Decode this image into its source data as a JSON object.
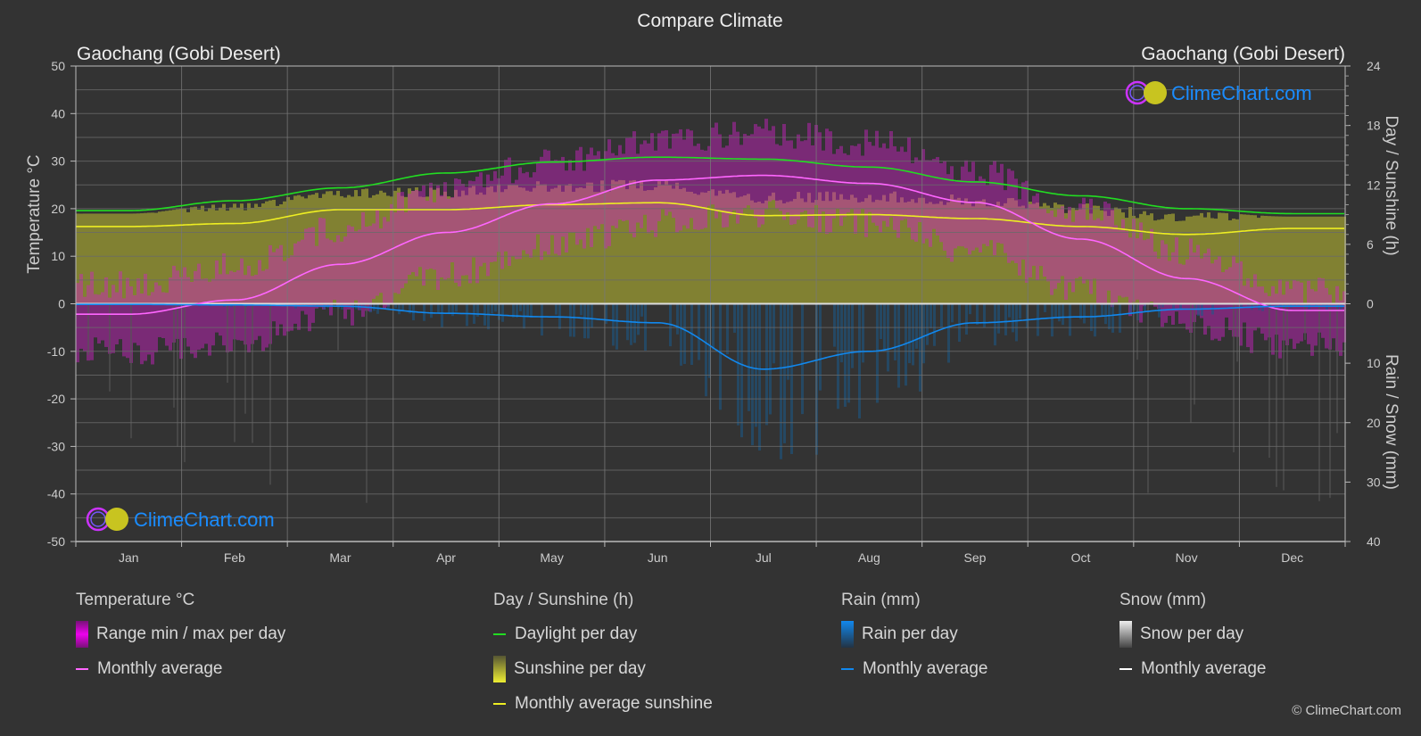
{
  "title": "Compare Climate",
  "location_left": "Gaochang (Gobi Desert)",
  "location_right": "Gaochang (Gobi Desert)",
  "watermark": "ClimeChart.com",
  "copyright": "© ClimeChart.com",
  "colors": {
    "background": "#333333",
    "grid": "#5a5a5a",
    "temp_avg": "#ff66ff",
    "temp_range": "#e000e0",
    "daylight": "#22dd22",
    "sunshine_avg": "#eeee22",
    "sunshine_fill": "#9a9a30",
    "rain_avg": "#1188ee",
    "rain_fill": "#1a5a8a",
    "snow_avg": "#ffffff",
    "brand_blue": "#1a8cff",
    "brand_magenta": "#cc33ff"
  },
  "legend": {
    "temperature": {
      "heading": "Temperature °C",
      "items": [
        "Range min / max per day",
        "Monthly average"
      ]
    },
    "sunshine": {
      "heading": "Day / Sunshine (h)",
      "items": [
        "Daylight per day",
        "Sunshine per day",
        "Monthly average sunshine"
      ]
    },
    "rain": {
      "heading": "Rain (mm)",
      "items": [
        "Rain per day",
        "Monthly average"
      ]
    },
    "snow": {
      "heading": "Snow (mm)",
      "items": [
        "Snow per day",
        "Monthly average"
      ]
    }
  },
  "chart_data": {
    "type": "line",
    "title": "Compare Climate",
    "categories": [
      "Jan",
      "Feb",
      "Mar",
      "Apr",
      "May",
      "Jun",
      "Jul",
      "Aug",
      "Sep",
      "Oct",
      "Nov",
      "Dec"
    ],
    "y_left": {
      "label": "Temperature °C",
      "range": [
        -50,
        50
      ],
      "ticks": [
        "50",
        "40",
        "30",
        "20",
        "10",
        "0",
        "-10",
        "-20",
        "-30",
        "-40",
        "-50"
      ]
    },
    "y_right_top": {
      "label": "Day / Sunshine (h)",
      "range": [
        0,
        24
      ],
      "ticks": [
        "24",
        "18",
        "12",
        "6",
        "0"
      ]
    },
    "y_right_bottom": {
      "label": "Rain / Snow (mm)",
      "range": [
        0,
        40
      ],
      "ticks": [
        "10",
        "20",
        "30",
        "40"
      ]
    },
    "grid": true,
    "legend_position": "bottom",
    "series": [
      {
        "name": "Temperature monthly average",
        "axis": "temp",
        "values": [
          -2.2,
          0.8,
          8.3,
          15.0,
          21.0,
          26.0,
          27.0,
          25.3,
          21.3,
          13.6,
          5.3,
          -1.4
        ]
      },
      {
        "name": "Temperature daily max (approx.)",
        "axis": "temp",
        "values": [
          4,
          8,
          16,
          24,
          30,
          34,
          36,
          34,
          28,
          20,
          11,
          3
        ]
      },
      {
        "name": "Temperature daily min (approx.)",
        "axis": "temp",
        "values": [
          -10,
          -8,
          -2,
          6,
          12,
          17,
          19,
          17,
          11,
          3,
          -4,
          -9
        ]
      },
      {
        "name": "Daylight per day",
        "axis": "sun",
        "values": [
          9.4,
          10.4,
          11.7,
          13.2,
          14.3,
          14.8,
          14.6,
          13.8,
          12.3,
          10.9,
          9.6,
          9.1
        ]
      },
      {
        "name": "Monthly average sunshine",
        "axis": "sun",
        "values": [
          7.8,
          8.1,
          9.5,
          9.5,
          10.0,
          10.2,
          8.9,
          9.0,
          8.6,
          7.8,
          7.0,
          7.6
        ]
      },
      {
        "name": "Rain monthly average",
        "axis": "rain",
        "values": [
          0.1,
          0.2,
          0.4,
          1.6,
          2.2,
          3.2,
          11.0,
          8.0,
          3.2,
          2.2,
          0.9,
          0.4
        ]
      },
      {
        "name": "Snow monthly average",
        "axis": "rain",
        "values": [
          0,
          0,
          0,
          0,
          0,
          0,
          0,
          0,
          0,
          0,
          0,
          0
        ]
      }
    ]
  }
}
